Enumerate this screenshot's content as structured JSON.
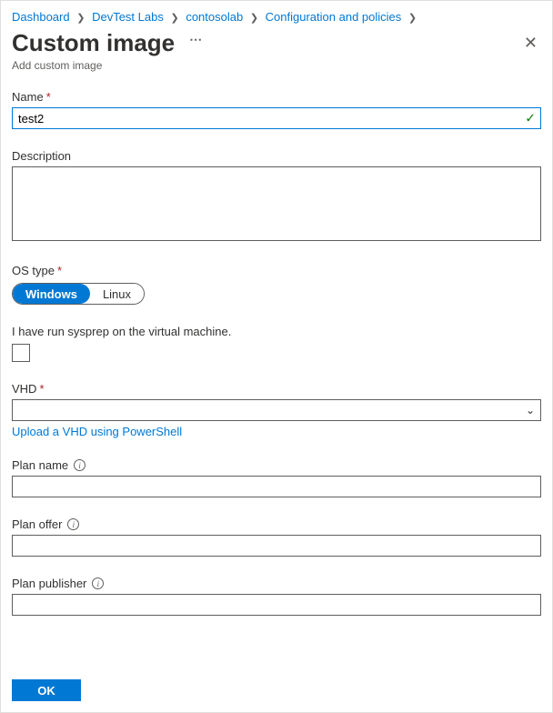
{
  "breadcrumb": {
    "items": [
      "Dashboard",
      "DevTest Labs",
      "contosolab",
      "Configuration and policies"
    ]
  },
  "header": {
    "title": "Custom image",
    "subtitle": "Add custom image"
  },
  "fields": {
    "name": {
      "label": "Name",
      "value": "test2"
    },
    "description": {
      "label": "Description",
      "value": ""
    },
    "os_type": {
      "label": "OS type",
      "options": [
        "Windows",
        "Linux"
      ],
      "selected": "Windows"
    },
    "sysprep": {
      "label": "I have run sysprep on the virtual machine."
    },
    "vhd": {
      "label": "VHD",
      "upload_link": "Upload a VHD using PowerShell"
    },
    "plan_name": {
      "label": "Plan name",
      "value": ""
    },
    "plan_offer": {
      "label": "Plan offer",
      "value": ""
    },
    "plan_publisher": {
      "label": "Plan publisher",
      "value": ""
    }
  },
  "buttons": {
    "ok": "OK"
  }
}
